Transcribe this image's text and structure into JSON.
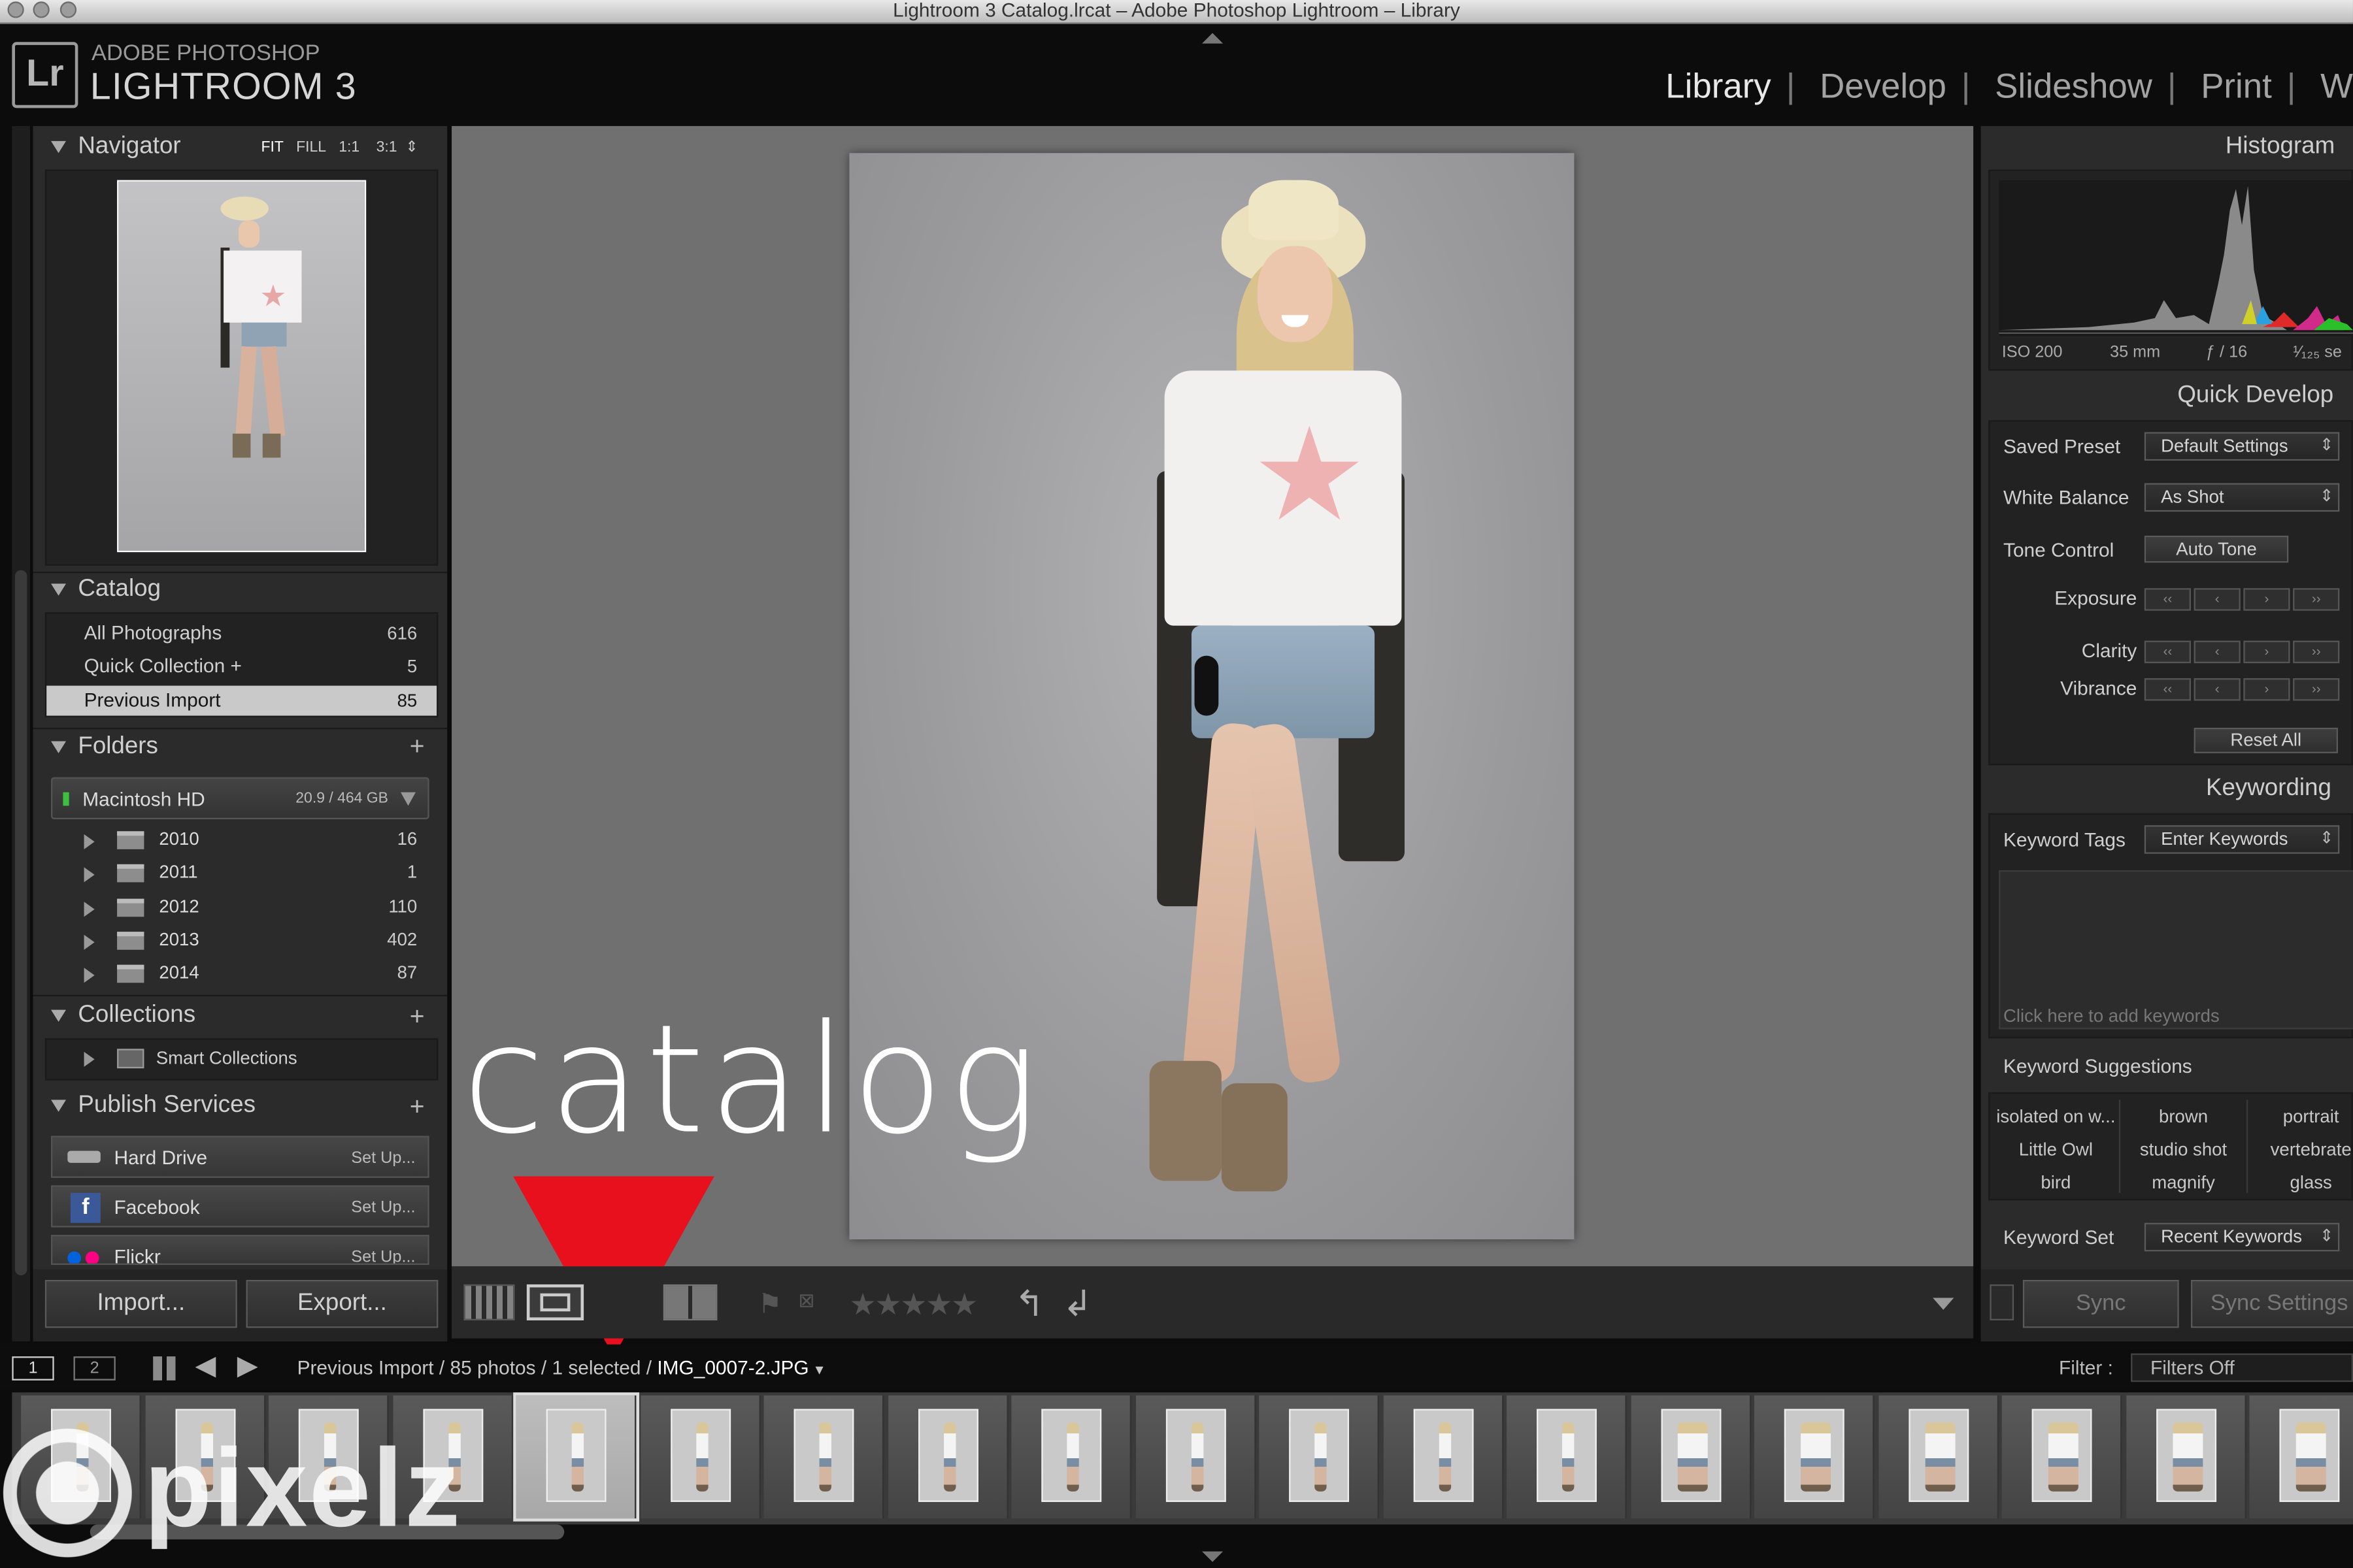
{
  "window": {
    "title": "Lightroom 3 Catalog.lrcat – Adobe Photoshop Lightroom – Library"
  },
  "identity": {
    "logo": "Lr",
    "line1": "ADOBE PHOTOSHOP",
    "line2": "LIGHTROOM 3"
  },
  "modules": [
    "Library",
    "Develop",
    "Slideshow",
    "Print",
    "W"
  ],
  "navigator": {
    "title": "Navigator",
    "zoom": [
      "FIT",
      "FILL",
      "1:1",
      "3:1"
    ]
  },
  "catalog": {
    "title": "Catalog",
    "items": [
      {
        "label": "All Photographs",
        "count": "616"
      },
      {
        "label": "Quick Collection +",
        "count": "5"
      },
      {
        "label": "Previous Import",
        "count": "85"
      }
    ]
  },
  "folders": {
    "title": "Folders",
    "volume": {
      "name": "Macintosh HD",
      "size": "20.9 / 464 GB"
    },
    "items": [
      {
        "label": "2010",
        "count": "16"
      },
      {
        "label": "2011",
        "count": "1"
      },
      {
        "label": "2012",
        "count": "110"
      },
      {
        "label": "2013",
        "count": "402"
      },
      {
        "label": "2014",
        "count": "87"
      }
    ]
  },
  "collections": {
    "title": "Collections",
    "items": [
      {
        "label": "Smart Collections"
      }
    ]
  },
  "publish": {
    "title": "Publish Services",
    "items": [
      {
        "label": "Hard Drive",
        "action": "Set Up..."
      },
      {
        "label": "Facebook",
        "action": "Set Up..."
      },
      {
        "label": "Flickr",
        "action": "Set Up..."
      }
    ]
  },
  "bottom_left": {
    "import": "Import...",
    "export": "Export..."
  },
  "overlay": {
    "text": "catalog",
    "arrow_color": "#e8101c"
  },
  "watermark": {
    "text": "pixelz"
  },
  "histogram": {
    "title": "Histogram",
    "meta": {
      "iso": "ISO 200",
      "focal": "35 mm",
      "aperture": "ƒ / 16",
      "shutter": "¹⁄₁₂₅ se"
    }
  },
  "quick_develop": {
    "title": "Quick Develop",
    "saved_preset": {
      "label": "Saved Preset",
      "value": "Default Settings"
    },
    "white_balance": {
      "label": "White Balance",
      "value": "As Shot"
    },
    "tone_control": {
      "label": "Tone Control",
      "button": "Auto Tone"
    },
    "exposure": "Exposure",
    "clarity": "Clarity",
    "vibrance": "Vibrance",
    "reset": "Reset All"
  },
  "keywording": {
    "title": "Keywording",
    "tags": {
      "label": "Keyword Tags",
      "value": "Enter Keywords"
    },
    "placeholder": "Click here to add keywords",
    "suggestions_title": "Keyword Suggestions",
    "suggestions": [
      "isolated on w...",
      "brown",
      "portrait",
      "Little Owl",
      "studio shot",
      "vertebrate",
      "bird",
      "magnify",
      "glass"
    ],
    "set": {
      "label": "Keyword Set",
      "value": "Recent Keywords"
    }
  },
  "sync": {
    "sync": "Sync",
    "sync_settings": "Sync Settings"
  },
  "filmstrip": {
    "pages": [
      "1",
      "2"
    ],
    "breadcrumb": "Previous Import / 85 photos / 1 selected / ",
    "filename": "IMG_0007-2.JPG",
    "filter_label": "Filter :",
    "filter_value": "Filters Off",
    "selected_index": 4,
    "thumb_count": 19
  },
  "colors": {
    "panel": "#2b2b2b",
    "canvas": "#707070",
    "selected_row": "#c9c9c9",
    "flag_red": "#e8101c"
  }
}
